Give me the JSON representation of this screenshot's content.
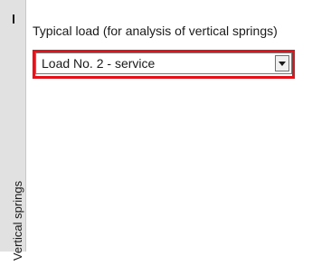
{
  "sidebar": {
    "tab_label": "Vertical springs"
  },
  "panel": {
    "group_label": "Typical load (for analysis of vertical springs)",
    "load_select": {
      "selected": "Load No. 2 - service"
    }
  },
  "colors": {
    "highlight": "#e3121b",
    "tab_bg": "#e1e1e1"
  },
  "icons": {
    "dropdown": "chevron-down-icon",
    "grip": "grip-icon"
  }
}
